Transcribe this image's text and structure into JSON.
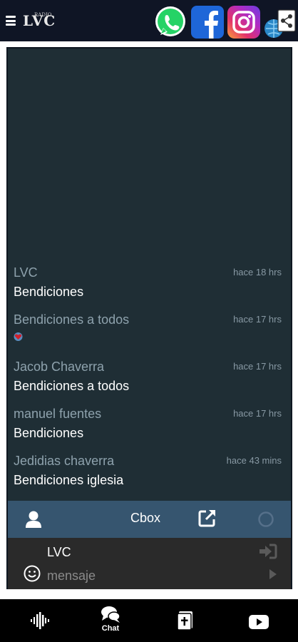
{
  "header": {
    "logo_text": "LVC",
    "logo_small": "RADIO",
    "icons": [
      "menu-icon",
      "whatsapp-icon",
      "facebook-icon",
      "instagram-icon",
      "web-share-icon"
    ]
  },
  "messages": [
    {
      "author": "LVC",
      "time": "hace 18 hrs",
      "text": "Bendiciones"
    },
    {
      "author": "Bendiciones a todos",
      "time": "hace 17 hrs",
      "text": ""
    },
    {
      "author": "Jacob Chaverra",
      "time": "hace 17 hrs",
      "text": "Bendiciones a todos"
    },
    {
      "author": "manuel fuentes",
      "time": "hace 17 hrs",
      "text": "Bendiciones"
    },
    {
      "author": "Jedidias chaverra",
      "time": "hace 43 mins",
      "text": "Bendiciones iglesia"
    }
  ],
  "cbox": {
    "title": "Cbox",
    "name_value": "LVC",
    "message_placeholder": "mensaje"
  },
  "nav": {
    "chat_label": "Chat"
  },
  "colors": {
    "topbar": "#0f1525",
    "chat_bg": "#1f2e35",
    "cbox_bar": "#36556f",
    "input_bg": "#2a2a2a",
    "nav_bg": "#000000"
  }
}
